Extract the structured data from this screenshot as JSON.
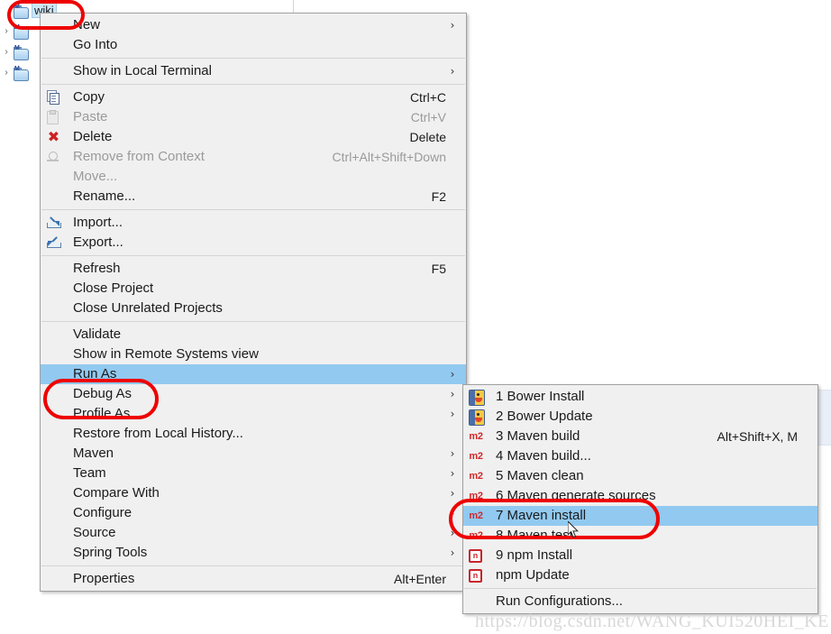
{
  "app": {
    "watermark": "https://blog.csdn.net/WANG_KUI520HEI_KE"
  },
  "project_tree": {
    "items": [
      {
        "label": "wiki",
        "icon": "maven-project-folder-icon",
        "selected": true,
        "expandable": false
      },
      {
        "label": "",
        "icon": "maven-project-folder-icon",
        "selected": false,
        "expandable": true
      },
      {
        "label": "",
        "icon": "maven-project-folder-icon",
        "selected": false,
        "expandable": true
      },
      {
        "label": "",
        "icon": "maven-project-folder-icon",
        "selected": false,
        "expandable": true
      }
    ]
  },
  "context_menu": {
    "name": "project-context-menu",
    "groups": [
      {
        "items": [
          {
            "label": "New",
            "accel": "",
            "icon": "",
            "submenu": true,
            "disabled": false,
            "highlighted": false
          },
          {
            "label": "Go Into",
            "accel": "",
            "icon": "",
            "submenu": false,
            "disabled": false,
            "highlighted": false
          }
        ]
      },
      {
        "items": [
          {
            "label": "Show in Local Terminal",
            "accel": "",
            "icon": "",
            "submenu": true,
            "disabled": false,
            "highlighted": false
          }
        ]
      },
      {
        "items": [
          {
            "label": "Copy",
            "accel": "Ctrl+C",
            "icon": "copy-icon",
            "submenu": false,
            "disabled": false,
            "highlighted": false
          },
          {
            "label": "Paste",
            "accel": "Ctrl+V",
            "icon": "paste-icon",
            "submenu": false,
            "disabled": true,
            "highlighted": false
          },
          {
            "label": "Delete",
            "accel": "Delete",
            "icon": "delete-icon",
            "submenu": false,
            "disabled": false,
            "highlighted": false
          },
          {
            "label": "Remove from Context",
            "accel": "Ctrl+Alt+Shift+Down",
            "icon": "remove-from-context-icon",
            "submenu": false,
            "disabled": true,
            "highlighted": false
          },
          {
            "label": "Move...",
            "accel": "",
            "icon": "",
            "submenu": false,
            "disabled": true,
            "highlighted": false
          },
          {
            "label": "Rename...",
            "accel": "F2",
            "icon": "",
            "submenu": false,
            "disabled": false,
            "highlighted": false
          }
        ]
      },
      {
        "items": [
          {
            "label": "Import...",
            "accel": "",
            "icon": "import-icon",
            "submenu": false,
            "disabled": false,
            "highlighted": false
          },
          {
            "label": "Export...",
            "accel": "",
            "icon": "export-icon",
            "submenu": false,
            "disabled": false,
            "highlighted": false
          }
        ]
      },
      {
        "items": [
          {
            "label": "Refresh",
            "accel": "F5",
            "icon": "",
            "submenu": false,
            "disabled": false,
            "highlighted": false
          },
          {
            "label": "Close Project",
            "accel": "",
            "icon": "",
            "submenu": false,
            "disabled": false,
            "highlighted": false
          },
          {
            "label": "Close Unrelated Projects",
            "accel": "",
            "icon": "",
            "submenu": false,
            "disabled": false,
            "highlighted": false
          }
        ]
      },
      {
        "items": [
          {
            "label": "Validate",
            "accel": "",
            "icon": "",
            "submenu": false,
            "disabled": false,
            "highlighted": false
          },
          {
            "label": "Show in Remote Systems view",
            "accel": "",
            "icon": "",
            "submenu": false,
            "disabled": false,
            "highlighted": false
          },
          {
            "label": "Run As",
            "accel": "",
            "icon": "",
            "submenu": true,
            "disabled": false,
            "highlighted": true
          },
          {
            "label": "Debug As",
            "accel": "",
            "icon": "",
            "submenu": true,
            "disabled": false,
            "highlighted": false
          },
          {
            "label": "Profile As",
            "accel": "",
            "icon": "",
            "submenu": true,
            "disabled": false,
            "highlighted": false
          },
          {
            "label": "Restore from Local History...",
            "accel": "",
            "icon": "",
            "submenu": false,
            "disabled": false,
            "highlighted": false
          },
          {
            "label": "Maven",
            "accel": "",
            "icon": "",
            "submenu": true,
            "disabled": false,
            "highlighted": false
          },
          {
            "label": "Team",
            "accel": "",
            "icon": "",
            "submenu": true,
            "disabled": false,
            "highlighted": false
          },
          {
            "label": "Compare With",
            "accel": "",
            "icon": "",
            "submenu": true,
            "disabled": false,
            "highlighted": false
          },
          {
            "label": "Configure",
            "accel": "",
            "icon": "",
            "submenu": true,
            "disabled": false,
            "highlighted": false
          },
          {
            "label": "Source",
            "accel": "",
            "icon": "",
            "submenu": true,
            "disabled": false,
            "highlighted": false
          },
          {
            "label": "Spring Tools",
            "accel": "",
            "icon": "",
            "submenu": true,
            "disabled": false,
            "highlighted": false
          }
        ]
      },
      {
        "items": [
          {
            "label": "Properties",
            "accel": "Alt+Enter",
            "icon": "",
            "submenu": false,
            "disabled": false,
            "highlighted": false
          }
        ]
      }
    ]
  },
  "run_as_submenu": {
    "name": "run-as-submenu",
    "groups": [
      {
        "items": [
          {
            "label": "1 Bower Install",
            "accel": "",
            "icon": "bower-icon",
            "highlighted": false
          },
          {
            "label": "2 Bower Update",
            "accel": "",
            "icon": "bower-icon",
            "highlighted": false
          },
          {
            "label": "3 Maven build",
            "accel": "Alt+Shift+X, M",
            "icon": "maven-m2-icon",
            "highlighted": false
          },
          {
            "label": "4 Maven build...",
            "accel": "",
            "icon": "maven-m2-icon",
            "highlighted": false
          },
          {
            "label": "5 Maven clean",
            "accel": "",
            "icon": "maven-m2-icon",
            "highlighted": false
          },
          {
            "label": "6 Maven generate sources",
            "accel": "",
            "icon": "maven-m2-icon",
            "highlighted": false
          },
          {
            "label": "7 Maven install",
            "accel": "",
            "icon": "maven-m2-icon",
            "highlighted": true
          },
          {
            "label": "8 Maven test",
            "accel": "",
            "icon": "maven-m2-icon",
            "highlighted": false
          },
          {
            "label": "9 npm Install",
            "accel": "",
            "icon": "npm-icon",
            "highlighted": false
          },
          {
            "label": "npm Update",
            "accel": "",
            "icon": "npm-icon",
            "highlighted": false
          }
        ]
      },
      {
        "items": [
          {
            "label": "Run Configurations...",
            "accel": "",
            "icon": "",
            "highlighted": false
          }
        ]
      }
    ]
  },
  "annotations": {
    "highlight_color": "#ee0000",
    "selection_color": "#91c9f0",
    "ovals": [
      {
        "target": "wiki"
      },
      {
        "target": "Run As"
      },
      {
        "target": "7 Maven install"
      }
    ]
  }
}
